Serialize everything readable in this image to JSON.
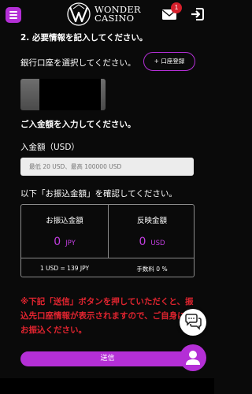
{
  "header": {
    "logo_line1": "WONDER",
    "logo_line2": "CASINO",
    "mail_badge": "1",
    "colors": {
      "accent": "#b42fd6",
      "badge": "#d51f2b"
    },
    "icons": [
      "menu-icon",
      "logo-mark-icon",
      "mail-icon",
      "login-icon"
    ]
  },
  "form": {
    "step_title": "2. 必要情報を記入してください。",
    "bank_select_label": "銀行口座を選択してください。",
    "add_bank_button": "+ 口座登録",
    "amount_instruction": "ご入金額を入力してください。",
    "amount_label": "入金額（USD）",
    "amount_placeholder": "最低 20 USD、最高 100000 USD",
    "confirm_title": "以下「お振込金額」を確認してください。"
  },
  "summary": {
    "transfer_label": "お振込金額",
    "transfer_value": "0",
    "transfer_unit": "JPY",
    "reflected_label": "反映金額",
    "reflected_value": "0",
    "reflected_unit": "USD",
    "rate": "1 USD = 139 JPY",
    "fee": "手数料 0 %",
    "value_color": "#c23ee0"
  },
  "notice": {
    "text": "※下記「送信」ボタンを押していただくと、振込先口座情報が表示されますので、ご自身にてお振込ください。",
    "color": "#e0242f"
  },
  "submit_button": "送信",
  "fabs": {
    "chat": "chat-icon",
    "user": "user-icon"
  }
}
